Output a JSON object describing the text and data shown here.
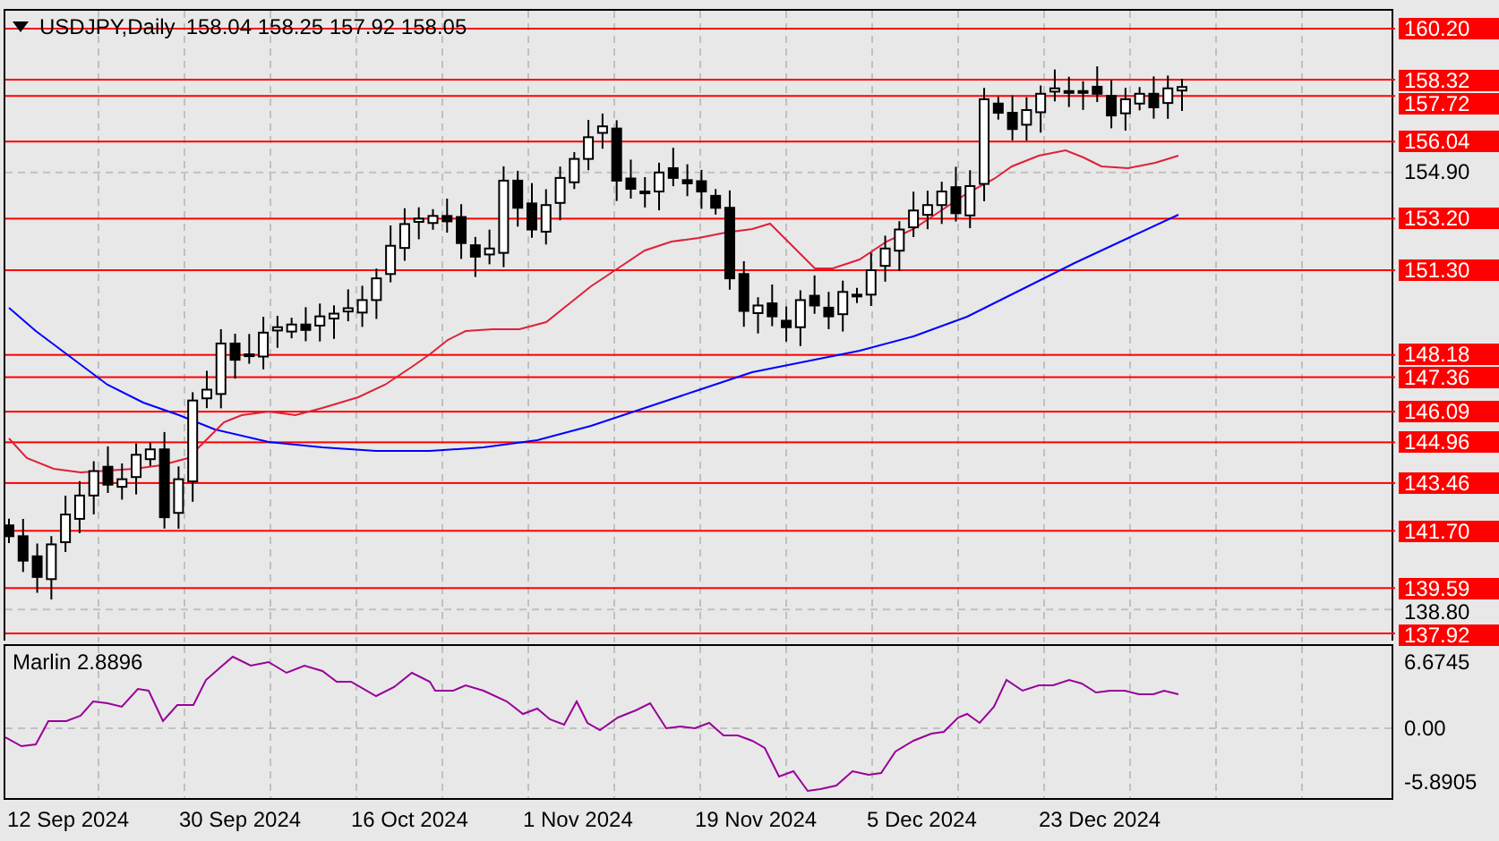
{
  "header": {
    "symbol": "USDJPY,Daily",
    "ohlc": "158.04 158.25 157.92 158.05"
  },
  "price_axis": [
    {
      "label": "160.20",
      "kind": "level"
    },
    {
      "label": "158.32",
      "kind": "level"
    },
    {
      "label": "157.72",
      "kind": "level"
    },
    {
      "label": "156.04",
      "kind": "level"
    },
    {
      "label": "154.90",
      "kind": "tick"
    },
    {
      "label": "153.20",
      "kind": "level"
    },
    {
      "label": "151.30",
      "kind": "level"
    },
    {
      "label": "148.18",
      "kind": "level"
    },
    {
      "label": "147.36",
      "kind": "level"
    },
    {
      "label": "146.09",
      "kind": "level"
    },
    {
      "label": "144.96",
      "kind": "level"
    },
    {
      "label": "143.46",
      "kind": "level"
    },
    {
      "label": "141.70",
      "kind": "level"
    },
    {
      "label": "139.59",
      "kind": "level"
    },
    {
      "label": "138.80",
      "kind": "tick"
    },
    {
      "label": "137.92",
      "kind": "level"
    }
  ],
  "indicator": {
    "title": "Marlin 2.8896",
    "axis": [
      "6.6745",
      "0.00",
      "-5.8905"
    ]
  },
  "time_axis": [
    "12 Sep 2024",
    "30 Sep 2024",
    "16 Oct 2024",
    "1 Nov 2024",
    "19 Nov 2024",
    "5 Dec 2024",
    "23 Dec 2024"
  ]
}
